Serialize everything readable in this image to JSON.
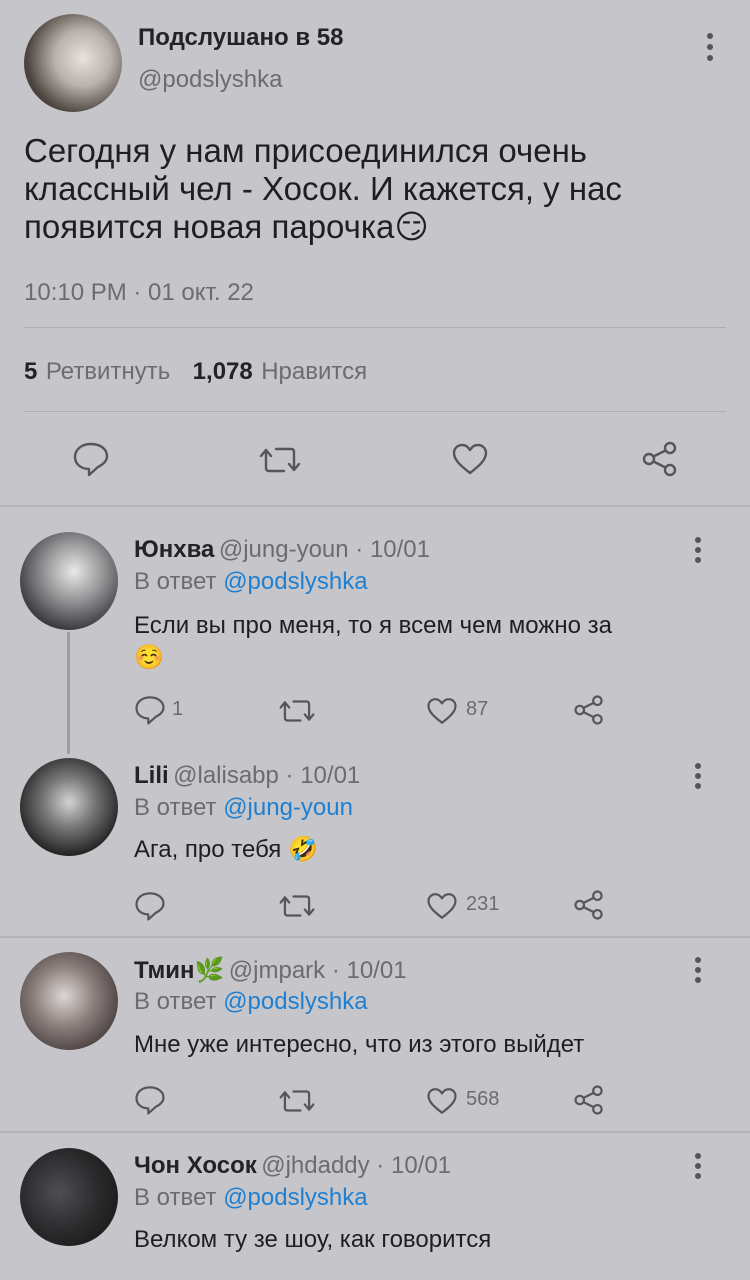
{
  "tweet": {
    "author_name": "Подслушано в 58",
    "author_handle": "@podslyshka",
    "text_line1": "Сегодня у нам присоединился очень",
    "text_line2": "классный чел - Хосок. И кажется, у нас",
    "text_line3": "появится новая парочка",
    "emoji": "😏",
    "timestamp": "10:10 PM · 01 окт. 22",
    "retweet_count": "5",
    "retweet_label": "Ретвитнуть",
    "like_count": "1,078",
    "like_label": "Нравится"
  },
  "replies": [
    {
      "name": "Юнхва",
      "handle_date": "@jung-youn · 10/01",
      "reply_prefix": "В ответ",
      "reply_to": "@podslyshka",
      "text": "Если вы про меня, то я всем чем можно за",
      "emoji": "☺️",
      "reply_count": "1",
      "like_count": "87"
    },
    {
      "name": "Lili",
      "handle_date": "@lalisabp · 10/01",
      "reply_prefix": "В ответ",
      "reply_to": "@jung-youn",
      "text": "Ага, про тебя",
      "emoji": "🤣",
      "reply_count": "",
      "like_count": "231"
    },
    {
      "name": "Тмин🌿",
      "handle_date": "@jmpark · 10/01",
      "reply_prefix": "В ответ",
      "reply_to": "@podslyshka",
      "text": "Мне уже интересно, что из этого выйдет",
      "reply_count": "",
      "like_count": "568"
    },
    {
      "name": "Чон Хосок",
      "handle_date": "@jhdaddy · 10/01",
      "reply_prefix": "В ответ",
      "reply_to": "@podslyshka",
      "text": "Велком ту зе шоу, как говорится"
    }
  ],
  "icons": {
    "more": "more-vertical-icon",
    "reply": "reply-icon",
    "retweet": "retweet-icon",
    "like": "heart-icon",
    "share": "share-icon"
  },
  "colors": {
    "background": "#c6c6ca",
    "link": "#1f7fd0",
    "secondary_text": "#6b6c70"
  }
}
